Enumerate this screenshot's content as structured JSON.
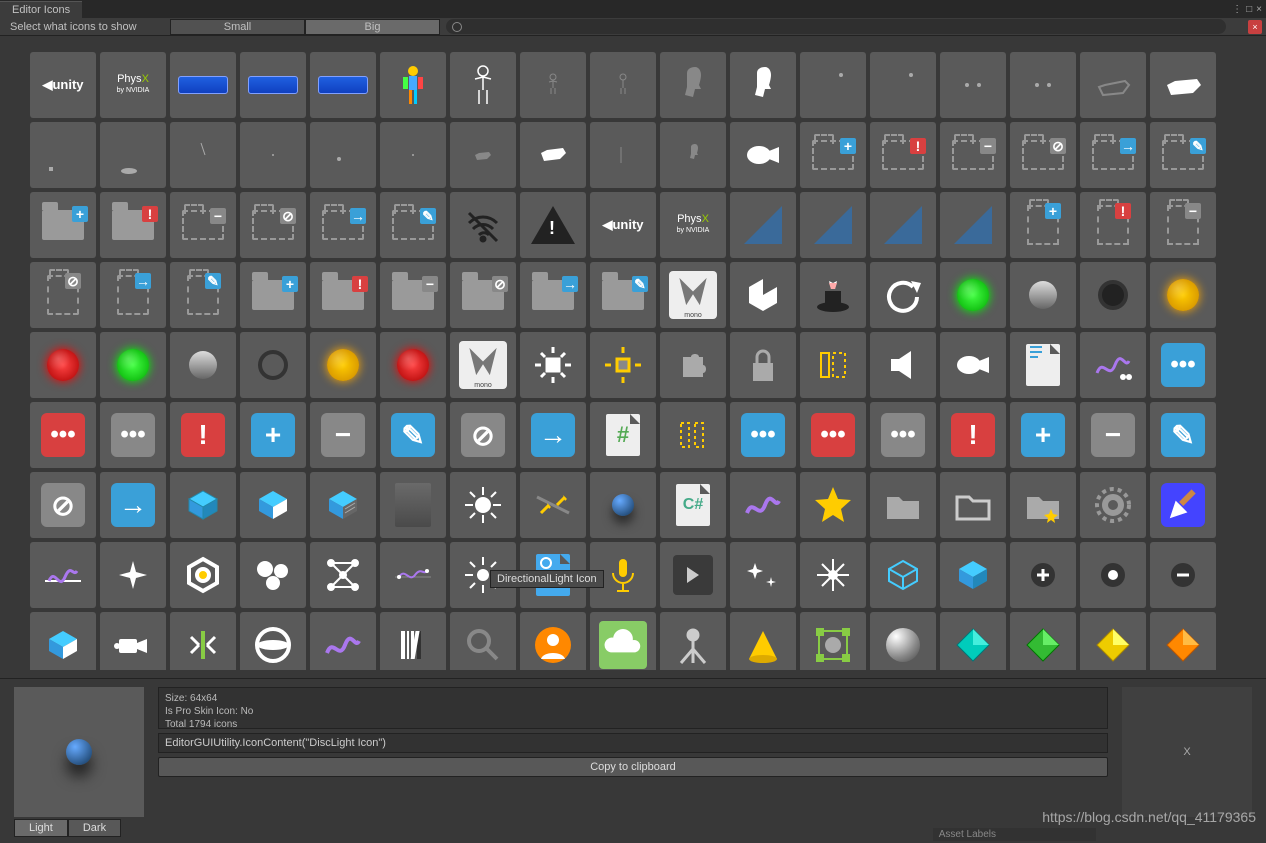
{
  "tab_title": "Editor Icons",
  "toolbar": {
    "label": "Select what icons to show",
    "small": "Small",
    "big": "Big",
    "search_placeholder": ""
  },
  "tooltip": "DirectionalLight Icon",
  "info": {
    "size": "Size: 64x64",
    "proskin": "Is Pro Skin Icon: No",
    "total": "Total 1794 icons",
    "code": "EditorGUIUtility.IconContent(\"DiscLight Icon\")",
    "copy": "Copy to clipboard"
  },
  "right_panel": "X",
  "theme": {
    "light": "Light",
    "dark": "Dark"
  },
  "asset_labels": "Asset Labels",
  "watermark": "https://blog.csdn.net/qq_41179365",
  "icons": {
    "r7": [
      "d_DiscLight",
      "d_DirectionalLight",
      "d_Prefab",
      "d_PrefabModel",
      "d_PrefabVariant",
      "d_Rect",
      "d_Light",
      "d_LightProbes",
      "d_ReflectionProbe",
      "d_Microphone",
      "d_GameManager",
      "d_ParticleSystem",
      "d_Flare",
      "d_Cube",
      "d_CubeBlue",
      "d_AddCircle",
      "d_RecordCircle",
      "d_RemoveCircle"
    ]
  }
}
